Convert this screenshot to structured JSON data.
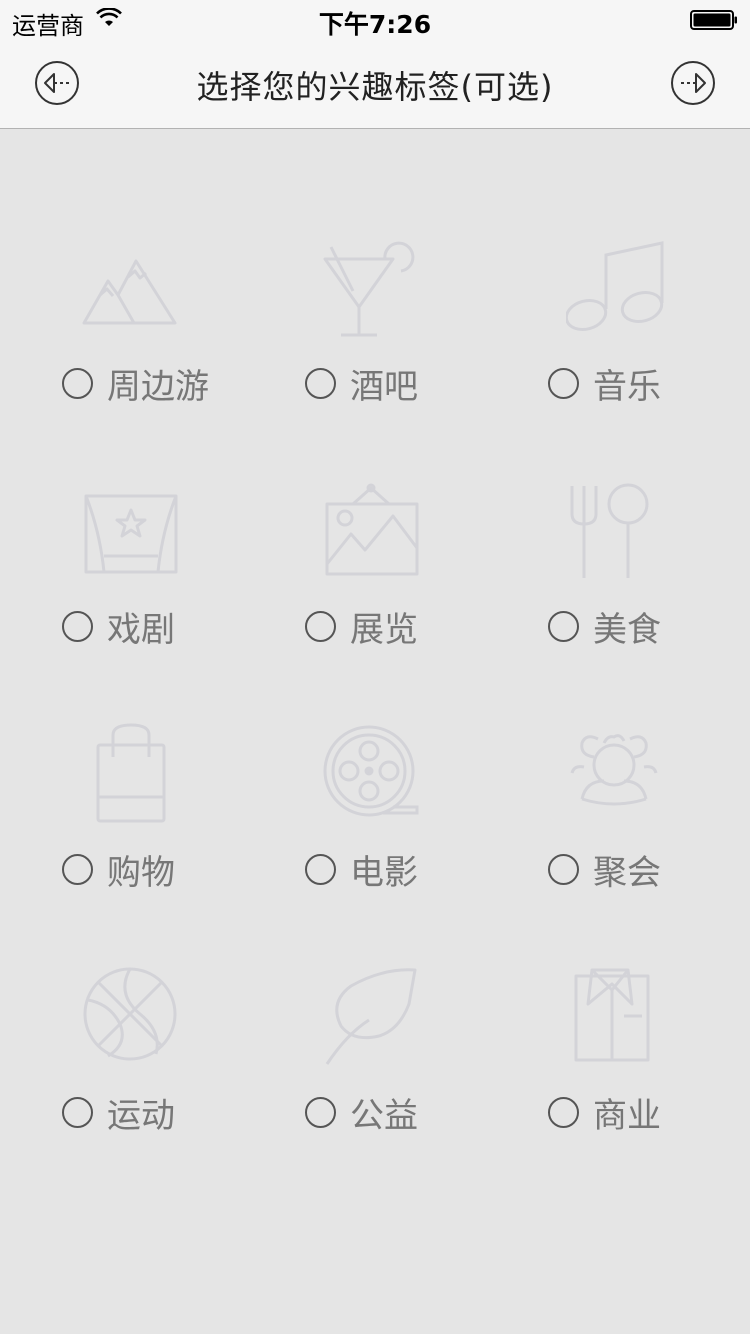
{
  "status_bar": {
    "carrier": "运营商",
    "time": "下午7:26",
    "icons": [
      "wifi-icon",
      "battery-icon"
    ]
  },
  "nav": {
    "title": "选择您的兴趣标签(可选)",
    "back_icon": "arrow-left-circle-icon",
    "next_icon": "arrow-right-circle-icon"
  },
  "tags": [
    {
      "label": "周边游",
      "icon": "mountain-icon",
      "selected": false
    },
    {
      "label": "酒吧",
      "icon": "cocktail-icon",
      "selected": false
    },
    {
      "label": "音乐",
      "icon": "music-note-icon",
      "selected": false
    },
    {
      "label": "戏剧",
      "icon": "theater-icon",
      "selected": false
    },
    {
      "label": "展览",
      "icon": "picture-frame-icon",
      "selected": false
    },
    {
      "label": "美食",
      "icon": "fork-spoon-icon",
      "selected": false
    },
    {
      "label": "购物",
      "icon": "shopping-bag-icon",
      "selected": false
    },
    {
      "label": "电影",
      "icon": "film-reel-icon",
      "selected": false
    },
    {
      "label": "聚会",
      "icon": "people-group-icon",
      "selected": false
    },
    {
      "label": "运动",
      "icon": "basketball-icon",
      "selected": false
    },
    {
      "label": "公益",
      "icon": "leaf-icon",
      "selected": false
    },
    {
      "label": "商业",
      "icon": "business-shirt-icon",
      "selected": false
    }
  ],
  "colors": {
    "background": "#e5e5e5",
    "bar": "#f6f6f6",
    "icon": "#d3d3d8",
    "label": "#777777",
    "radio": "#555555"
  }
}
